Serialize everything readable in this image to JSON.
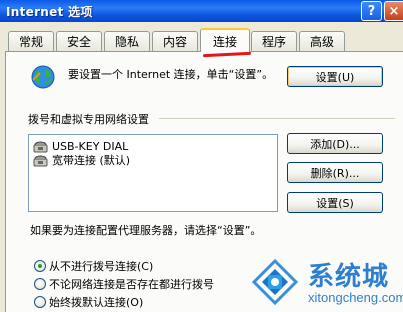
{
  "window": {
    "title": "Internet 选项"
  },
  "titlebar": {
    "help_label": "?",
    "close_label": "×"
  },
  "tabs": [
    "常规",
    "安全",
    "隐私",
    "内容",
    "连接",
    "程序",
    "高级"
  ],
  "setup": {
    "text": "要设置一个 Internet 连接，单击“设置”。",
    "button": "设置(U)"
  },
  "dialup": {
    "group_label": "拨号和虚拟专用网络设置",
    "items": [
      "USB-KEY DIAL",
      "宽带连接 (默认)"
    ],
    "add_button": "添加(D)...",
    "delete_button": "删除(R)...",
    "settings_button": "设置(S)"
  },
  "proxy": {
    "text": "如果要为连接配置代理服务器，请选择“设置”。",
    "options": [
      {
        "label": "从不进行拨号连接(C)",
        "selected": true
      },
      {
        "label": "不论网络连接是否存在都进行拨号",
        "selected": false
      },
      {
        "label": "始终拨默认连接(O)",
        "selected": false
      }
    ]
  },
  "watermark": {
    "name": "系统城",
    "url": "xitongcheng.com"
  },
  "colors": {
    "titlebar": "#0a5ae8",
    "panel": "#fbfbf9",
    "dialog": "#ece9d8",
    "accent_tab": "#ffc83c",
    "annotation_red": "#e0181b"
  }
}
